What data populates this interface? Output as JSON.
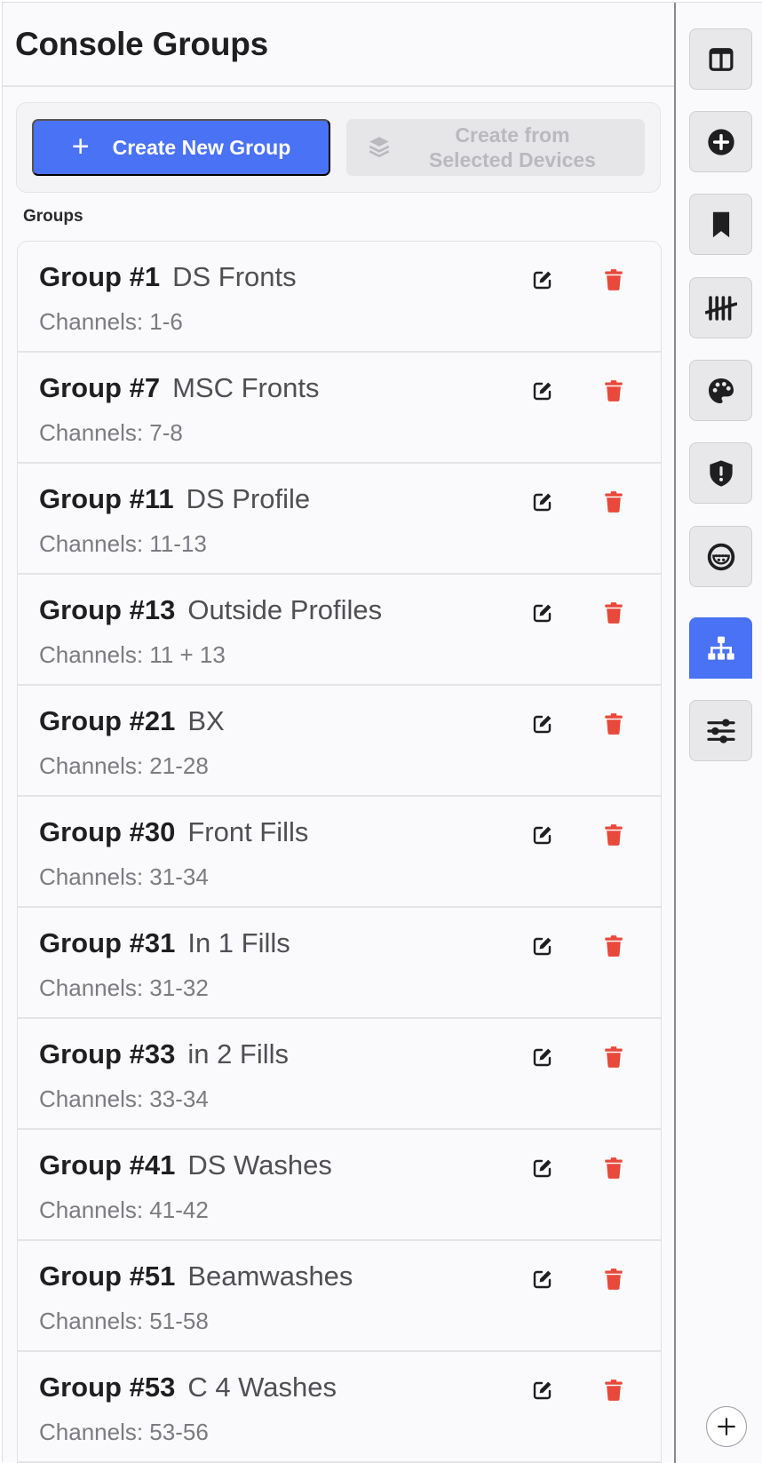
{
  "panel": {
    "title": "Console Groups",
    "create_new_label": "Create New Group",
    "create_from_line1": "Create from",
    "create_from_line2": "Selected Devices",
    "groups_label": "Groups"
  },
  "groups": [
    {
      "number": "Group #1",
      "name": "DS Fronts",
      "channels": "Channels: 1-6"
    },
    {
      "number": "Group #7",
      "name": "MSC Fronts",
      "channels": "Channels: 7-8"
    },
    {
      "number": "Group #11",
      "name": "DS Profile",
      "channels": "Channels: 11-13"
    },
    {
      "number": "Group #13",
      "name": "Outside Profiles",
      "channels": "Channels: 11 + 13"
    },
    {
      "number": "Group #21",
      "name": "BX",
      "channels": "Channels: 21-28"
    },
    {
      "number": "Group #30",
      "name": "Front Fills",
      "channels": "Channels: 31-34"
    },
    {
      "number": "Group #31",
      "name": "In 1 Fills",
      "channels": "Channels: 31-32"
    },
    {
      "number": "Group #33",
      "name": "in 2 Fills",
      "channels": "Channels: 33-34"
    },
    {
      "number": "Group #41",
      "name": "DS Washes",
      "channels": "Channels: 41-42"
    },
    {
      "number": "Group #51",
      "name": "Beamwashes",
      "channels": "Channels: 51-58"
    },
    {
      "number": "Group #53",
      "name": "C 4 Washes",
      "channels": "Channels: 53-56"
    }
  ],
  "row_icons": {
    "edit": "edit-icon",
    "delete": "trash-icon"
  },
  "rail": {
    "items": [
      {
        "icon": "columns-icon"
      },
      {
        "icon": "plus-circle-icon"
      },
      {
        "icon": "bookmark-icon"
      },
      {
        "icon": "tally-icon"
      },
      {
        "icon": "palette-icon"
      },
      {
        "icon": "shield-alert-icon"
      },
      {
        "icon": "dmx-connector-icon"
      },
      {
        "icon": "hierarchy-icon",
        "active": true
      },
      {
        "icon": "sliders-icon"
      }
    ],
    "add_icon": "plus-icon"
  },
  "colors": {
    "accent": "#4a72f5",
    "delete": "#e8493b",
    "disabled_bg": "#e6e6e9",
    "disabled_text": "#b9b9be"
  }
}
